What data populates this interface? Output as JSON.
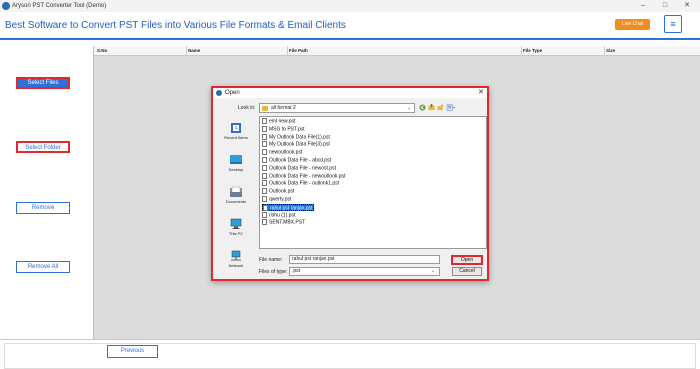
{
  "window": {
    "title": "Aryson PST Converter Tool (Demo)",
    "minimize": "–",
    "maximize": "□",
    "close": "✕"
  },
  "header": {
    "heading": "Best Software to Convert PST Files into Various File Formats & Email Clients",
    "live_chat": "Live Chat",
    "menu_icon": "≡"
  },
  "sidebar": {
    "select_files": "Select Files",
    "select_folder": "Select Folder",
    "remove": "Remove",
    "remove_all": "Remove All"
  },
  "grid": {
    "columns": [
      "S.No",
      "Name",
      "File Path",
      "File Type",
      "Size"
    ]
  },
  "footer": {
    "previous": "Previous"
  },
  "dialog": {
    "title": "Open",
    "close": "✕",
    "look_in_label": "Look in:",
    "look_in_value": "all format 2",
    "places": [
      "Recent Items",
      "Desktop",
      "Documents",
      "This PC",
      "Network"
    ],
    "files": [
      "eml new.pst",
      "MSG to PST.pst",
      "My Outlook Data File(1).pst",
      "My Outlook Data File(3).pst",
      "newoutlook.pst",
      "Outlook Data File - abcd.pst",
      "Outlook Data File - newost.pst",
      "Outlook Data File - newoutlook.pst",
      "Outlook Data File - outlonk1.pst",
      "Outlook.pst",
      "qwerty.pst",
      "rahul pst ranjan.pst",
      "rishu (1).pst",
      "SENT.MBX.PST"
    ],
    "selected_index": 11,
    "file_name_label": "File name:",
    "file_name_value": "rahul pst ranjan.pst",
    "file_type_label": "Files of type:",
    "file_type_value": ".pst",
    "open": "Open",
    "cancel": "Cancel"
  }
}
